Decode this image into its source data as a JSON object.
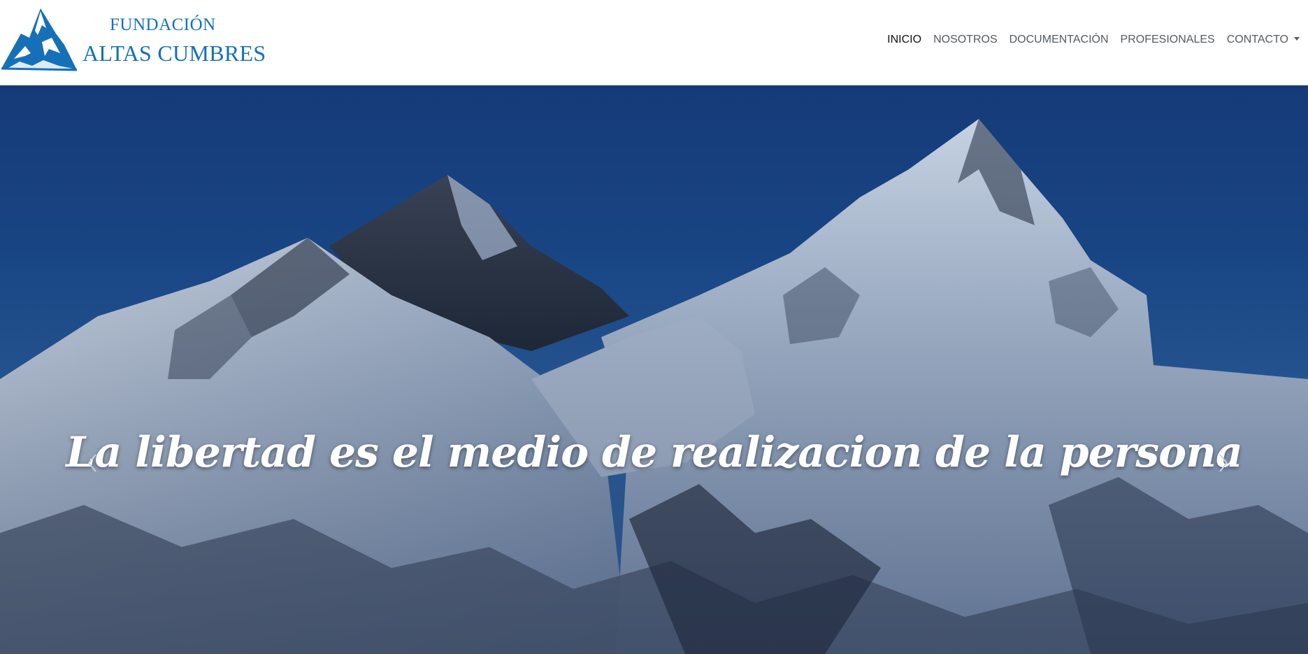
{
  "brand": {
    "line1": "FUNDACIÓN",
    "line2": "ALTAS CUMBRES",
    "logo_icon": "mountain-logo-icon",
    "color": "#1670b8"
  },
  "nav": {
    "items": [
      {
        "label": "INICIO",
        "active": true
      },
      {
        "label": "NOSOTROS",
        "active": false
      },
      {
        "label": "DOCUMENTACIÓN",
        "active": false
      },
      {
        "label": "PROFESIONALES",
        "active": false
      },
      {
        "label": "CONTACTO",
        "active": false,
        "dropdown": true
      }
    ]
  },
  "hero": {
    "caption": "La libertad es el medio de realizacion de la persona",
    "prev_icon": "chevron-left-icon",
    "next_icon": "chevron-right-icon",
    "sky_color": "#1a4a8c"
  }
}
